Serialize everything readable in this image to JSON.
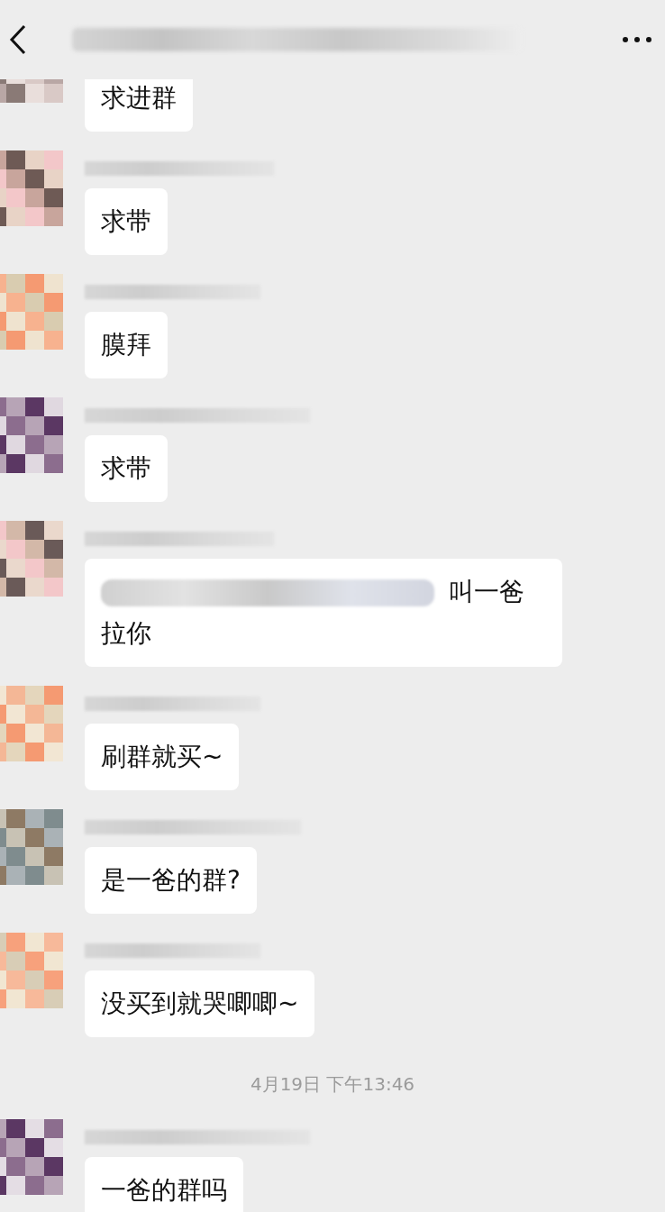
{
  "messages": [
    {
      "kind": "message",
      "text": "求进群"
    },
    {
      "kind": "message",
      "text": "求带"
    },
    {
      "kind": "message",
      "text": "膜拜"
    },
    {
      "kind": "message",
      "text": "求带"
    },
    {
      "kind": "message",
      "text": "叫一爸拉你",
      "redacted_prefix": true
    },
    {
      "kind": "message",
      "text": "刷群就买~"
    },
    {
      "kind": "message",
      "text": "是一爸的群?"
    },
    {
      "kind": "message",
      "text": "没买到就哭唧唧~"
    },
    {
      "kind": "time",
      "text": "4月19日 下午13:46"
    },
    {
      "kind": "message",
      "text": "一爸的群吗"
    }
  ]
}
